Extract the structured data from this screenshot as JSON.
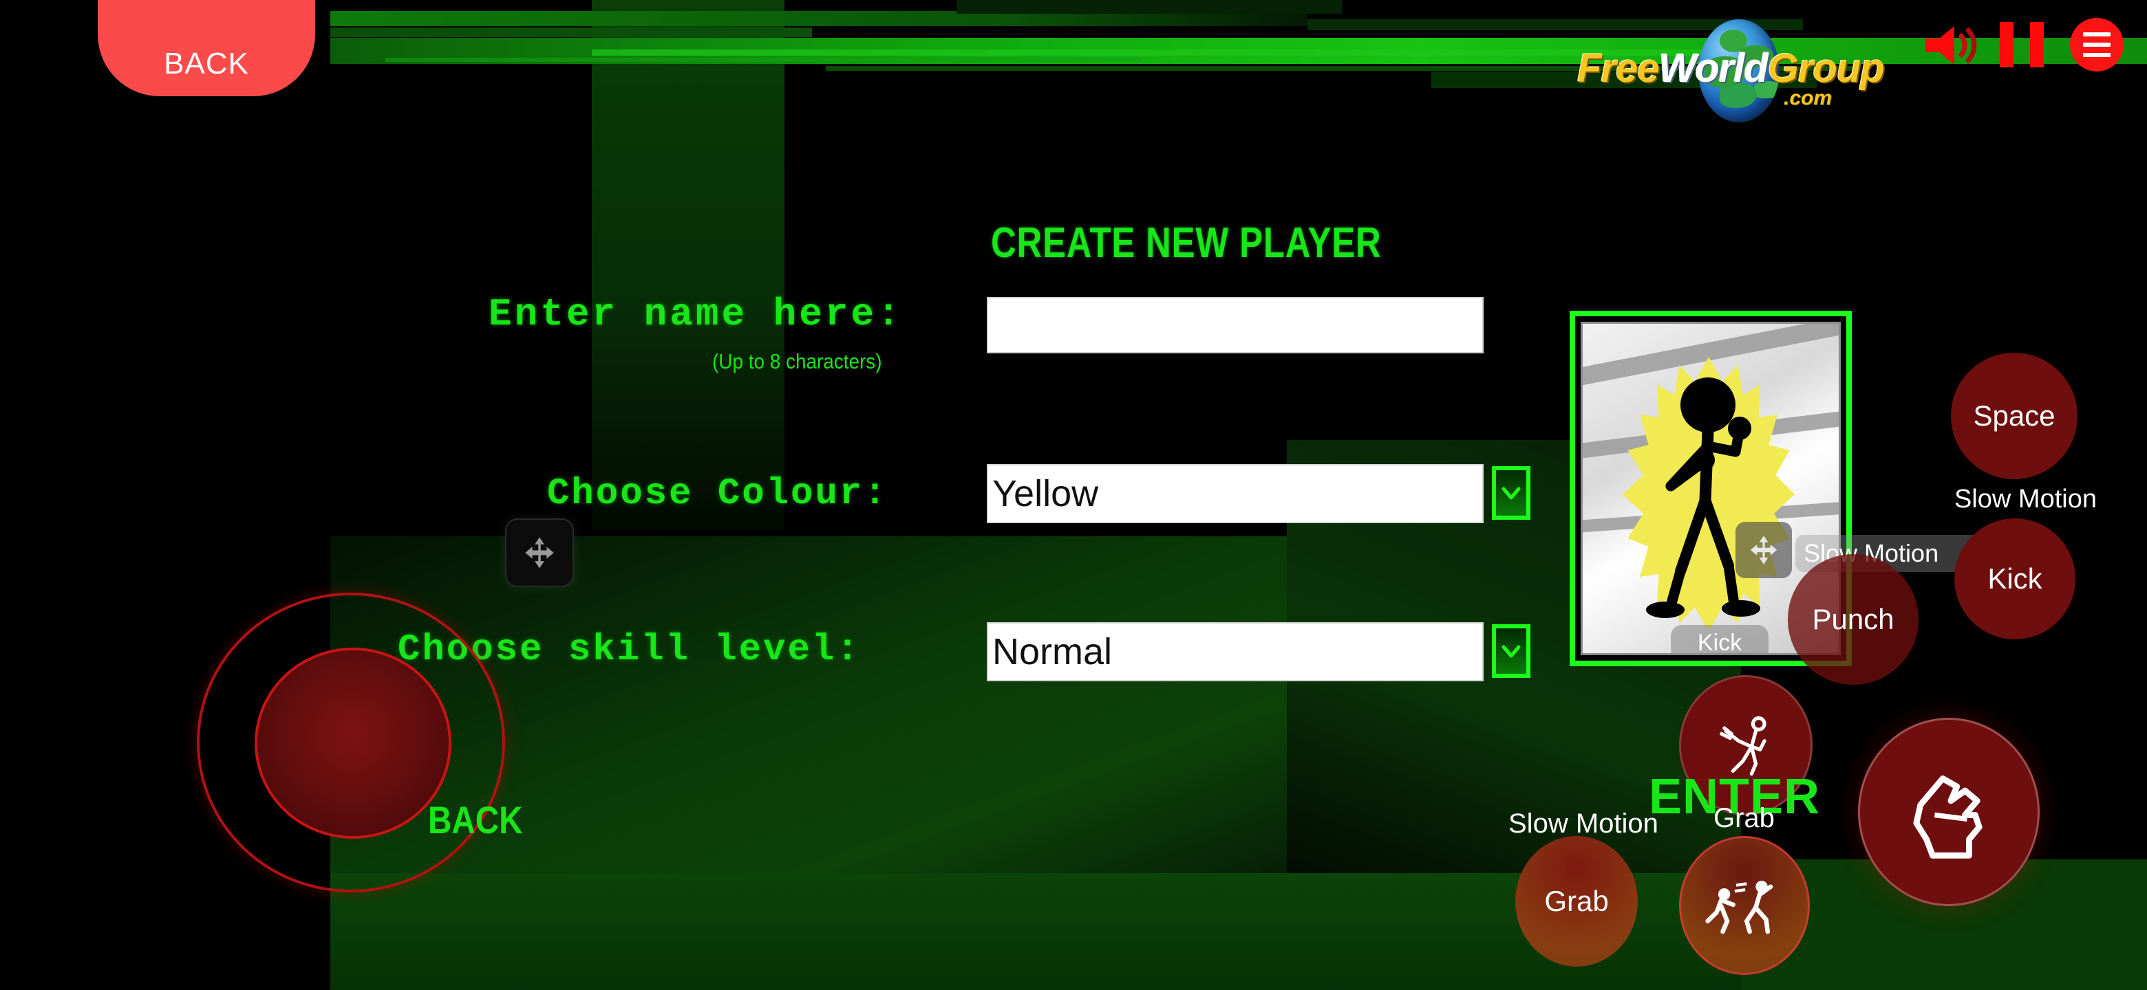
{
  "app": {
    "screen_title": "CREATE NEW PLAYER",
    "background_color": "#000000",
    "accent_green": "#19e619",
    "accent_red": "#fa4a4a"
  },
  "topbar": {
    "back_label": "BACK",
    "logo": {
      "part1": "Free",
      "part2": "World",
      "part3": "Group",
      "dotcom": ".com",
      "gold_color": "#f7c621",
      "white_color": "#ffffff"
    },
    "icons": {
      "speaker": "speaker-volume-icon",
      "pause": "pause-icon",
      "menu": "hamburger-menu-icon"
    }
  },
  "form": {
    "name_label": "Enter name here:",
    "name_hint": "(Up to 8 characters)",
    "name_value": "",
    "name_placeholder": "",
    "colour_label": "Choose Colour:",
    "colour_value": "Yellow",
    "skill_label": "Choose skill level:",
    "skill_value": "Normal",
    "chevron_icon": "chevron-down-icon"
  },
  "preview": {
    "character_color": "Yellow",
    "slow_motion_label": "Slow Motion",
    "kick_label": "Kick",
    "move_handle_icon": "move-arrows-icon",
    "border_color": "#1bff1b"
  },
  "controls": {
    "space_label": "Space",
    "slow_motion_right_label": "Slow Motion",
    "kick_label": "Kick",
    "punch_label": "Punch",
    "slow_motion_left_label": "Slow Motion",
    "grab_mid_label": "Grab",
    "grab_round_label": "Grab",
    "enter_label": "ENTER",
    "back_label": "BACK",
    "icons": {
      "kick_figure": "kick-figure-icon",
      "fist": "fist-icon",
      "grab_figures": "grab-figures-icon",
      "joystick": "joystick-icon",
      "move_handle": "move-arrows-icon"
    }
  }
}
